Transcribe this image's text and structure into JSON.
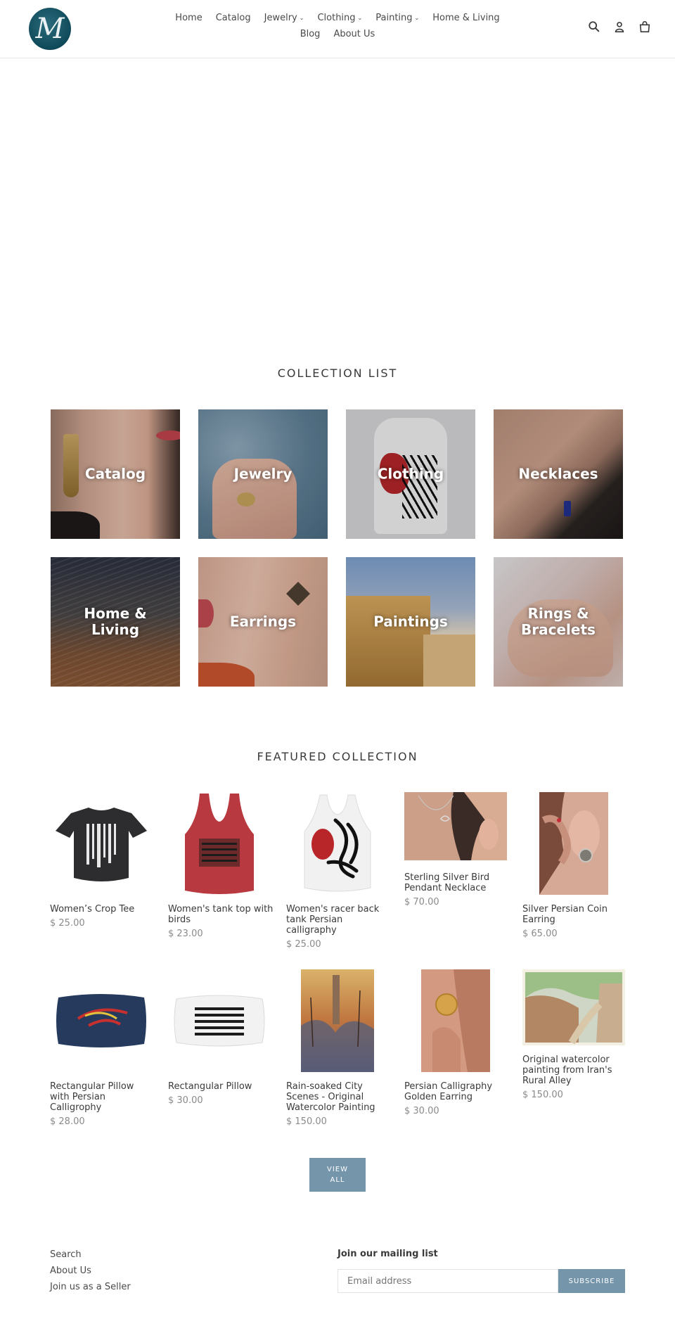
{
  "brand": {
    "logo_letter": "M",
    "name": "M"
  },
  "nav": {
    "row1": [
      {
        "label": "Home",
        "dropdown": false
      },
      {
        "label": "Catalog",
        "dropdown": false
      },
      {
        "label": "Jewelry",
        "dropdown": true
      },
      {
        "label": "Clothing",
        "dropdown": true
      },
      {
        "label": "Painting",
        "dropdown": true
      },
      {
        "label": "Home & Living",
        "dropdown": false
      }
    ],
    "row2": [
      {
        "label": "Blog",
        "dropdown": false
      },
      {
        "label": "About Us",
        "dropdown": false
      }
    ],
    "icons": [
      "search-icon",
      "account-icon",
      "cart-icon"
    ]
  },
  "collection_list": {
    "title": "COLLECTION LIST",
    "items": [
      {
        "label": "Catalog"
      },
      {
        "label": "Jewelry"
      },
      {
        "label": "Clothing"
      },
      {
        "label": "Necklaces"
      },
      {
        "label": "Home & Living"
      },
      {
        "label": "Earrings"
      },
      {
        "label": "Paintings"
      },
      {
        "label": "Rings & Bracelets"
      }
    ]
  },
  "featured": {
    "title": "FEATURED COLLECTION",
    "products": [
      {
        "title": "Women’s Crop Tee",
        "price": "$ 25.00"
      },
      {
        "title": "Women's tank top with birds",
        "price": "$ 23.00"
      },
      {
        "title": "Women's racer back tank Persian calligraphy",
        "price": "$ 25.00"
      },
      {
        "title": "Sterling Silver Bird Pendant Necklace",
        "price": "$ 70.00"
      },
      {
        "title": "Silver Persian Coin Earring",
        "price": "$ 65.00"
      },
      {
        "title": "Rectangular Pillow with Persian Calligrophy",
        "price": "$ 28.00"
      },
      {
        "title": "Rectangular Pillow",
        "price": "$ 30.00"
      },
      {
        "title": "Rain-soaked City Scenes - Original Watercolor Painting",
        "price": "$ 150.00"
      },
      {
        "title": "Persian Calligraphy Golden Earring",
        "price": "$ 30.00"
      },
      {
        "title": "Original watercolor painting from Iran's Rural Alley",
        "price": "$ 150.00"
      }
    ],
    "view_all_line1": "VIEW",
    "view_all_line2": "ALL"
  },
  "footer": {
    "links": [
      "Search",
      "About Us",
      "Join us as a Seller"
    ],
    "mailing_title": "Join our mailing list",
    "email_placeholder": "Email address",
    "subscribe_label": "SUBSCRIBE"
  },
  "colors": {
    "accent": "#7595ab",
    "logo_bg": "#0f4a5a"
  }
}
